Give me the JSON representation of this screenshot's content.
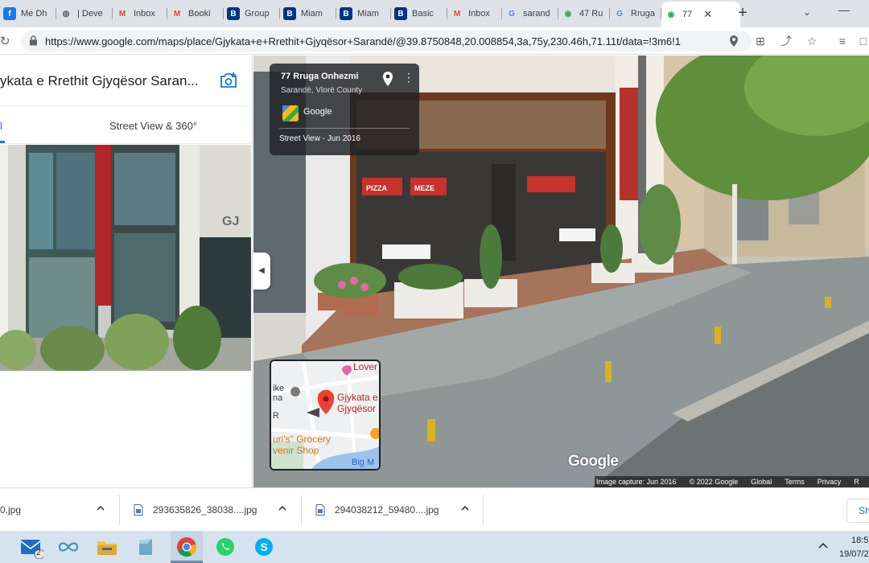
{
  "browser": {
    "tabs": [
      {
        "title": "Me Dh",
        "icon": "facebook-icon",
        "color": "#1877f2"
      },
      {
        "title": "| Deve",
        "icon": "globe-icon",
        "color": "#5f6368"
      },
      {
        "title": "Inbox",
        "icon": "gmail-icon",
        "color": "#ea4335"
      },
      {
        "title": "Booki",
        "icon": "gmail-icon",
        "color": "#ea4335"
      },
      {
        "title": "Group",
        "icon": "booking-icon",
        "color": "#003580"
      },
      {
        "title": "Miam",
        "icon": "booking-icon",
        "color": "#003580"
      },
      {
        "title": "Miam",
        "icon": "booking-icon",
        "color": "#003580"
      },
      {
        "title": "Basic",
        "icon": "booking-icon",
        "color": "#003580"
      },
      {
        "title": "Inbox",
        "icon": "gmail-icon",
        "color": "#ea4335"
      },
      {
        "title": "sarand",
        "icon": "google-icon",
        "color": "#4285f4"
      },
      {
        "title": "47 Ru",
        "icon": "maps-icon",
        "color": "#34a853"
      },
      {
        "title": "Rruga",
        "icon": "google-icon",
        "color": "#4285f4"
      },
      {
        "title": "77",
        "icon": "maps-icon",
        "color": "#34a853",
        "active": true
      }
    ],
    "url": "https://www.google.com/maps/place/Gjykata+e+Rrethit+Gjyqësor+Sarandë/@39.8750848,20.008854,3a,75y,230.46h,71.11t/data=!3m6!1"
  },
  "left_panel": {
    "place_title": "ykata e Rrethit Gjyqësor Saran...",
    "tab_all": "l",
    "tab_street_view": "Street View & 360°"
  },
  "street_view": {
    "address": "77 Rruga Onhezmi",
    "locality": "Sarandë, Vlorë County",
    "provider": "Google",
    "date": "Street View - Jun 2016",
    "watermark": "Google",
    "attribution": [
      "Image capture: Jun 2016",
      "© 2022 Google",
      "Global",
      "Terms",
      "Privacy",
      "R"
    ],
    "minimap": {
      "labels": [
        "Lover",
        "Gjykata e",
        "Gjyqësor",
        "ike",
        "na",
        "R",
        "uri's\" Grocery",
        "venir Shop",
        "Big M"
      ]
    },
    "storefront_signs": [
      "PIZZA",
      "MEZE"
    ]
  },
  "downloads": [
    {
      "name": "0.jpg"
    },
    {
      "name": "293635826_38038....jpg"
    },
    {
      "name": "294038212_59480....jpg"
    }
  ],
  "downloads_show_all": "Sh",
  "taskbar": {
    "mail_badge": "2",
    "clock_time": "18:5",
    "clock_date": "19/07/2"
  },
  "colors": {
    "accent": "#1a73e8",
    "tabbar_bg": "#dfe3e8",
    "taskbar_bg": "#d6e3ee",
    "map_pin": "#ea4335"
  }
}
